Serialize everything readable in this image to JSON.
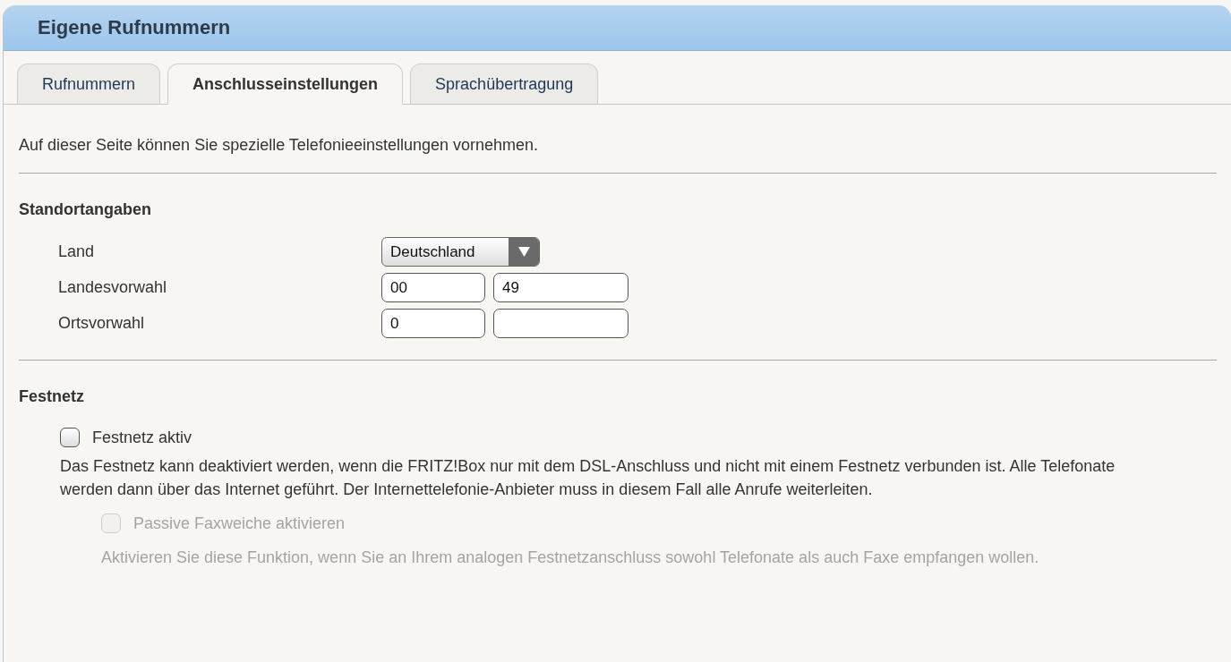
{
  "window": {
    "title": "Eigene Rufnummern"
  },
  "tabs": [
    {
      "label": "Rufnummern",
      "selected": false
    },
    {
      "label": "Anschlusseinstellungen",
      "selected": true
    },
    {
      "label": "Sprachübertragung",
      "selected": false
    }
  ],
  "intro": "Auf dieser Seite können Sie spezielle Telefonieeinstellungen vornehmen.",
  "location": {
    "heading": "Standortangaben",
    "rows": [
      {
        "label": "Land",
        "kind": "select",
        "value": "Deutschland"
      },
      {
        "label": "Landesvorwahl",
        "kind": "pair",
        "values": [
          "00",
          "49"
        ]
      },
      {
        "label": "Ortsvorwahl",
        "kind": "pair",
        "values": [
          "0"
        ]
      }
    ]
  },
  "landline": {
    "heading": "Festnetz",
    "options": [
      {
        "label": "Festnetz aktiv",
        "checked": false,
        "disabled": false,
        "description": "Das Festnetz kann deaktiviert werden, wenn die FRITZ!Box nur mit dem DSL-Anschluss und nicht mit einem Festnetz verbunden ist. Alle Telefonate werden dann über das Internet geführt. Der Internettelefonie-Anbieter muss in diesem Fall alle Anrufe weiterleiten.",
        "children": [
          {
            "label": "Passive Faxweiche aktivieren",
            "checked": false,
            "disabled": true,
            "description": "Aktivieren Sie diese Funktion, wenn Sie an Ihrem analogen Festnetzanschluss sowohl Telefonate als auch Faxe empfangen wollen."
          }
        ]
      }
    ]
  }
}
